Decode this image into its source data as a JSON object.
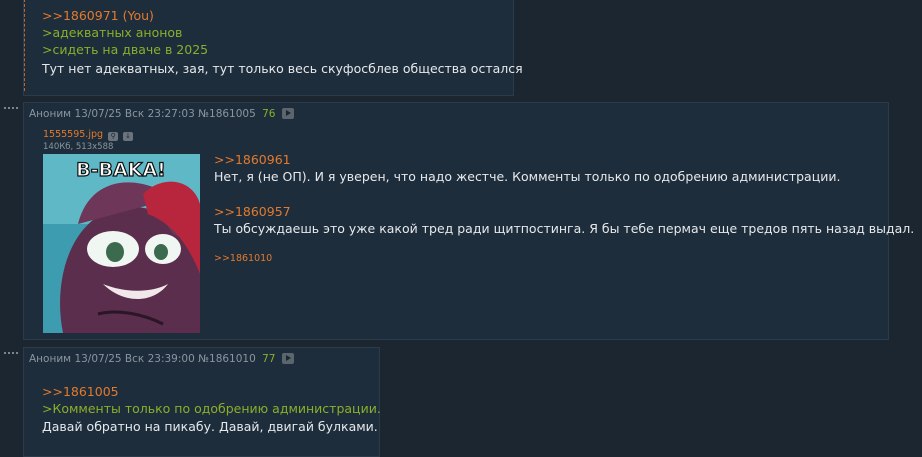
{
  "posts": [
    {
      "lines": [
        {
          "text": ">>1860971 (You)",
          "kind": "link"
        },
        {
          "text": ">адекватных анонов",
          "kind": "green"
        },
        {
          "text": ">сидеть на дваче в 2025",
          "kind": "green"
        },
        {
          "text": "Тут нет адекватных, зая, тут только весь скуфосблев общества остался",
          "kind": "text"
        }
      ]
    },
    {
      "author": "Аноним",
      "date": "13/07/25 Вск 23:27:03",
      "num": "№1861005",
      "count": "76",
      "file": {
        "name": "1555595.jpg",
        "meta": "140Кб, 513x588",
        "image_text": "B-BAKA!"
      },
      "lines": [
        {
          "text": ">>1860961",
          "kind": "link"
        },
        {
          "text": "Нет, я (не ОП). И я уверен, что надо жестче. Комменты только по одобрению администрации.",
          "kind": "text"
        },
        {
          "text": ">>1860957",
          "kind": "link"
        },
        {
          "text": "Ты обсуждаешь это уже какой тред ради щитпостинга. Я бы тебе пермач еще тредов пять назад выдал.",
          "kind": "text"
        }
      ],
      "reply": ">>1861010"
    },
    {
      "author": "Аноним",
      "date": "13/07/25 Вск 23:39:00",
      "num": "№1861010",
      "count": "77",
      "lines": [
        {
          "text": ">>1861005",
          "kind": "link"
        },
        {
          "text": ">Комменты только по одобрению администрации.",
          "kind": "green"
        },
        {
          "text": "Давай обратно на пикабу. Давай, двигай булками.",
          "kind": "text"
        }
      ]
    }
  ],
  "colors": {
    "bg": "#1c2631",
    "post": "#1e2d3b",
    "link": "#e27a2d",
    "greentext": "#8aaf2b",
    "meta": "#8a959e"
  },
  "icons": [
    "search-icon",
    "download-icon",
    "post-menu-icon"
  ]
}
